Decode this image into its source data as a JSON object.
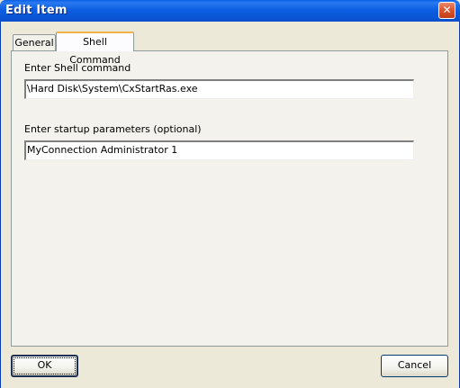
{
  "window": {
    "title": "Edit Item",
    "close_glyph": "✕"
  },
  "tabs": [
    {
      "label": "General",
      "selected": false
    },
    {
      "label": "Shell Command",
      "selected": true
    }
  ],
  "form": {
    "shell_command_label": "Enter Shell command",
    "shell_command_value": "\\Hard Disk\\System\\CxStartRas.exe",
    "params_label": "Enter startup parameters (optional)",
    "params_value": "MyConnection Administrator 1"
  },
  "buttons": {
    "ok": "OK",
    "cancel": "Cancel"
  },
  "colors": {
    "titlebar": "#0a55d6",
    "dialog_face": "#ece9d8",
    "close_button": "#d9532c",
    "tab_highlight": "#f0b34a"
  }
}
